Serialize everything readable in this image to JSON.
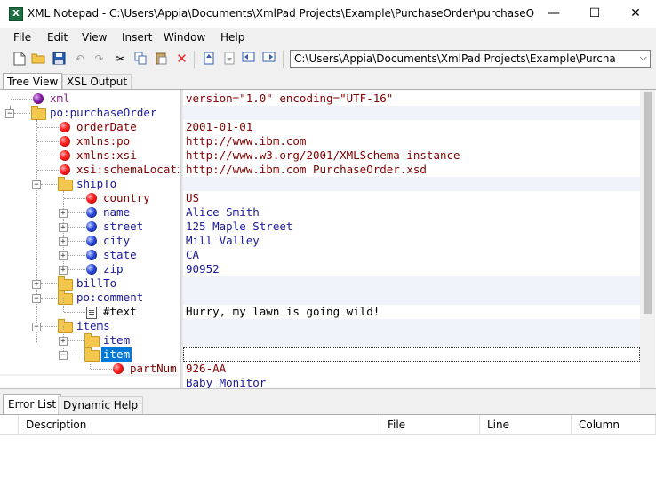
{
  "window": {
    "title": "XML Notepad - C:\\Users\\Appia\\Documents\\XmlPad Projects\\Example\\PurchaseOrder\\purchaseOr...",
    "minimize": "—",
    "maximize": "☐",
    "close": "✕"
  },
  "menu": [
    "File",
    "Edit",
    "View",
    "Insert",
    "Window",
    "Help"
  ],
  "toolbar": {
    "path": "C:\\Users\\Appia\\Documents\\XmlPad Projects\\Example\\Purcha"
  },
  "tabs_top": [
    "Tree View",
    "XSL Output"
  ],
  "tree": [
    {
      "label": "xml",
      "value": "version=\"1.0\" encoding=\"UTF-16\""
    },
    {
      "label": "po:purchaseOrder",
      "value": ""
    },
    {
      "label": "orderDate",
      "value": "2001-01-01"
    },
    {
      "label": "xmlns:po",
      "value": "http://www.ibm.com"
    },
    {
      "label": "xmlns:xsi",
      "value": "http://www.w3.org/2001/XMLSchema-instance"
    },
    {
      "label": "xsi:schemaLocation",
      "value": "http://www.ibm.com PurchaseOrder.xsd"
    },
    {
      "label": "shipTo",
      "value": ""
    },
    {
      "label": "country",
      "value": "US"
    },
    {
      "label": "name",
      "value": "Alice Smith"
    },
    {
      "label": "street",
      "value": "125 Maple Street"
    },
    {
      "label": "city",
      "value": "Mill Valley"
    },
    {
      "label": "state",
      "value": "CA"
    },
    {
      "label": "zip",
      "value": "90952"
    },
    {
      "label": "billTo",
      "value": ""
    },
    {
      "label": "po:comment",
      "value": ""
    },
    {
      "label": "#text",
      "value": "Hurry, my lawn is going wild!"
    },
    {
      "label": "items",
      "value": ""
    },
    {
      "label": "item",
      "value": ""
    },
    {
      "label": "item",
      "value": ""
    },
    {
      "label": "partNum",
      "value": "926-AA"
    },
    {
      "label": "",
      "value": "Baby Monitor"
    }
  ],
  "tabs_bottom": [
    "Error List",
    "Dynamic Help"
  ],
  "error_columns": [
    "",
    "Description",
    "File",
    "Line",
    "Column"
  ]
}
